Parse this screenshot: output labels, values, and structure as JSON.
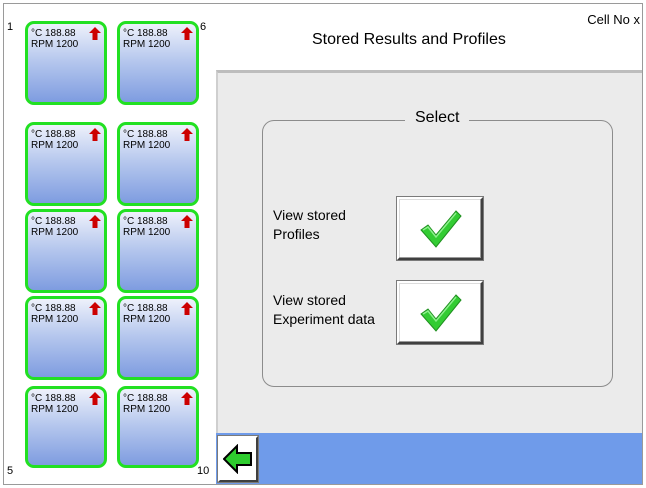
{
  "header": {
    "title": "Stored Results and Profiles",
    "cell_no": "Cell No  x"
  },
  "cell_panel": {
    "numbers": {
      "top_left": "1",
      "top_right": "6",
      "bottom_left": "5",
      "bottom_right": "10"
    },
    "cells": [
      {
        "temp": "°C 188.88",
        "rpm": "RPM 1200"
      },
      {
        "temp": "°C 188.88",
        "rpm": "RPM 1200"
      },
      {
        "temp": "°C 188.88",
        "rpm": "RPM 1200"
      },
      {
        "temp": "°C 188.88",
        "rpm": "RPM 1200"
      },
      {
        "temp": "°C 188.88",
        "rpm": "RPM 1200"
      },
      {
        "temp": "°C 188.88",
        "rpm": "RPM 1200"
      },
      {
        "temp": "°C 188.88",
        "rpm": "RPM 1200"
      },
      {
        "temp": "°C 188.88",
        "rpm": "RPM 1200"
      },
      {
        "temp": "°C 188.88",
        "rpm": "RPM 1200"
      },
      {
        "temp": "°C 188.88",
        "rpm": "RPM 1200"
      }
    ]
  },
  "select_group": {
    "label": "Select",
    "options": [
      {
        "line1": "View stored",
        "line2": "Profiles",
        "icon": "checkmark-icon"
      },
      {
        "line1": "View stored",
        "line2": "Experiment data",
        "icon": "checkmark-icon"
      }
    ]
  },
  "footer": {
    "back_icon": "back-arrow-icon"
  },
  "colors": {
    "cell_border": "#22e022",
    "cell_gradient_top": "#eef1fb",
    "cell_gradient_bottom": "#7e9ce0",
    "arrow": "#cc0000",
    "footer_bar": "#6f9bea",
    "check": "#33cc33",
    "main_bg": "#ebebeb"
  }
}
